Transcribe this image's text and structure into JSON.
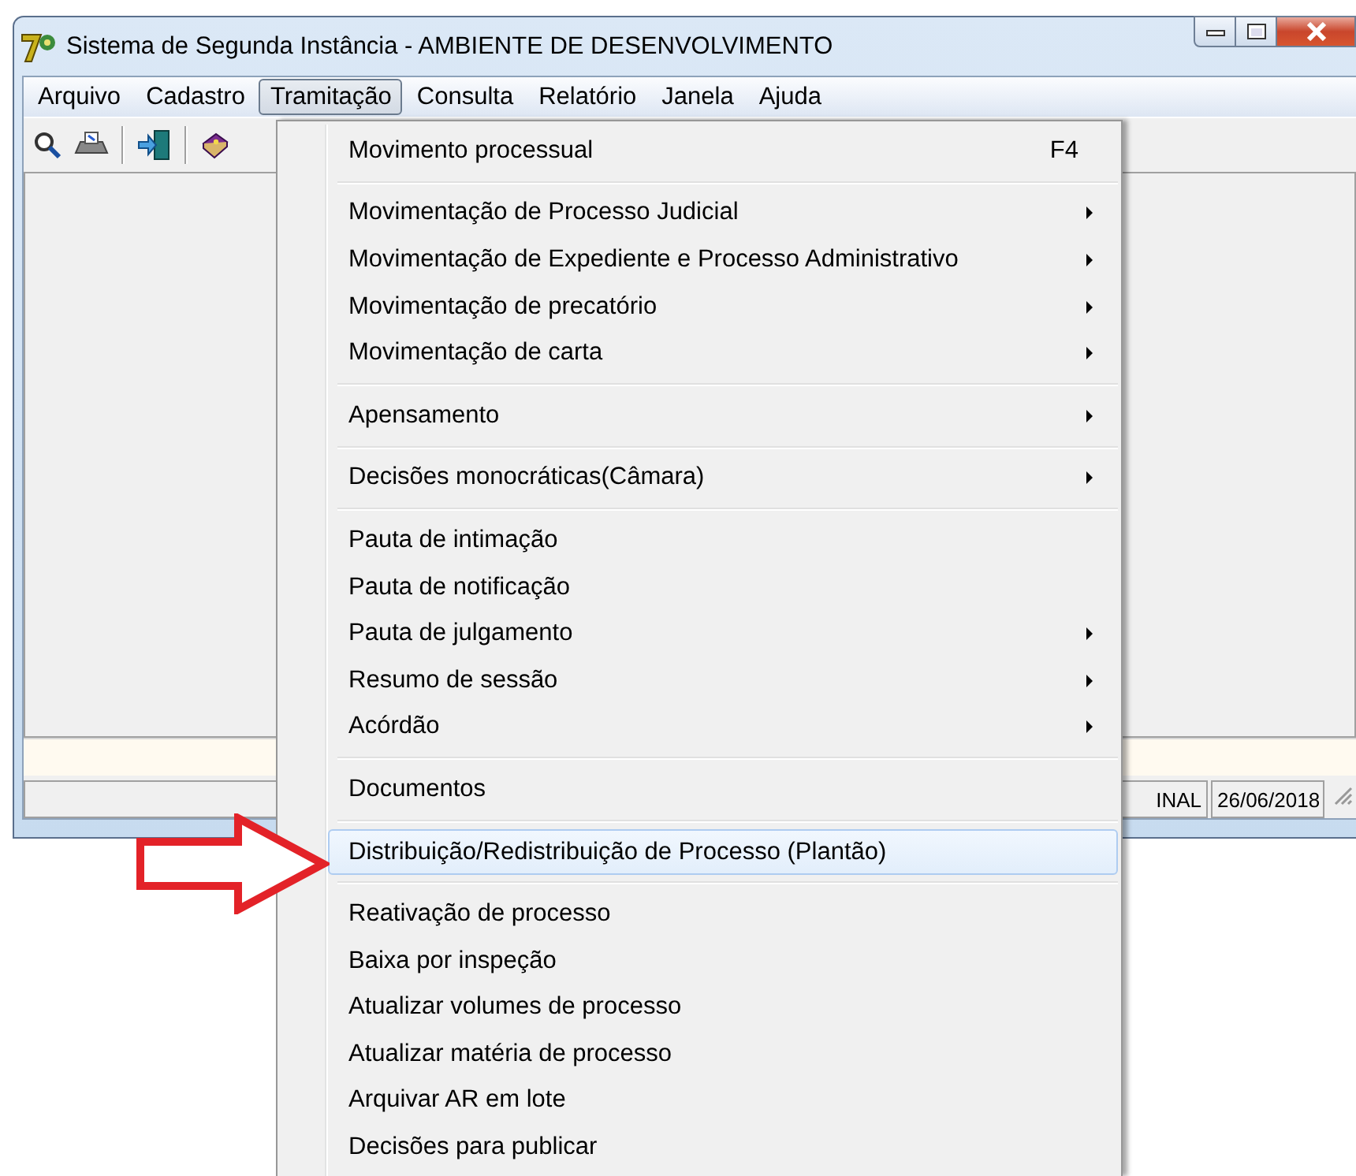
{
  "window": {
    "title": "Sistema de Segunda Instância - AMBIENTE DE DESENVOLVIMENTO"
  },
  "menu_bar": [
    {
      "label": "Arquivo",
      "selected": false
    },
    {
      "label": "Cadastro",
      "selected": false
    },
    {
      "label": "Tramitação",
      "selected": true
    },
    {
      "label": "Consulta",
      "selected": false
    },
    {
      "label": "Relatório",
      "selected": false
    },
    {
      "label": "Janela",
      "selected": false
    },
    {
      "label": "Ajuda",
      "selected": false
    }
  ],
  "dropdown_menu": [
    {
      "kind": "item",
      "label": "Movimento processual",
      "shortcut": "F4",
      "submenu": false,
      "selected": false
    },
    {
      "kind": "separator"
    },
    {
      "kind": "item",
      "label": "Movimentação de Processo Judicial",
      "submenu": true,
      "selected": false
    },
    {
      "kind": "item",
      "label": "Movimentação de Expediente e Processo Administrativo",
      "submenu": true,
      "selected": false
    },
    {
      "kind": "item",
      "label": "Movimentação de precatório",
      "submenu": true,
      "selected": false
    },
    {
      "kind": "item",
      "label": "Movimentação de carta",
      "submenu": true,
      "selected": false
    },
    {
      "kind": "separator"
    },
    {
      "kind": "item",
      "label": "Apensamento",
      "submenu": true,
      "selected": false
    },
    {
      "kind": "separator"
    },
    {
      "kind": "item",
      "label": "Decisões monocráticas(Câmara)",
      "submenu": true,
      "selected": false
    },
    {
      "kind": "separator"
    },
    {
      "kind": "item",
      "label": "Pauta de intimação",
      "submenu": false,
      "selected": false
    },
    {
      "kind": "item",
      "label": "Pauta de notificação",
      "submenu": false,
      "selected": false
    },
    {
      "kind": "item",
      "label": "Pauta de julgamento",
      "submenu": true,
      "selected": false
    },
    {
      "kind": "item",
      "label": "Resumo de sessão",
      "submenu": true,
      "selected": false
    },
    {
      "kind": "item",
      "label": "Acórdão",
      "submenu": true,
      "selected": false
    },
    {
      "kind": "separator"
    },
    {
      "kind": "item",
      "label": "Documentos",
      "submenu": false,
      "selected": false
    },
    {
      "kind": "separator"
    },
    {
      "kind": "item",
      "label": "Distribuição/Redistribuição de Processo (Plantão)",
      "submenu": false,
      "selected": true
    },
    {
      "kind": "separator"
    },
    {
      "kind": "item",
      "label": "Reativação de processo",
      "submenu": false,
      "selected": false
    },
    {
      "kind": "item",
      "label": "Baixa por inspeção",
      "submenu": false,
      "selected": false
    },
    {
      "kind": "item",
      "label": "Atualizar volumes de processo",
      "submenu": false,
      "selected": false
    },
    {
      "kind": "item",
      "label": "Atualizar matéria de processo",
      "submenu": false,
      "selected": false
    },
    {
      "kind": "item",
      "label": "Arquivar AR em lote",
      "submenu": false,
      "selected": false
    },
    {
      "kind": "item",
      "label": "Decisões para publicar",
      "submenu": false,
      "selected": false
    }
  ],
  "status_bar": [
    "INAL",
    "26/06/2018"
  ]
}
